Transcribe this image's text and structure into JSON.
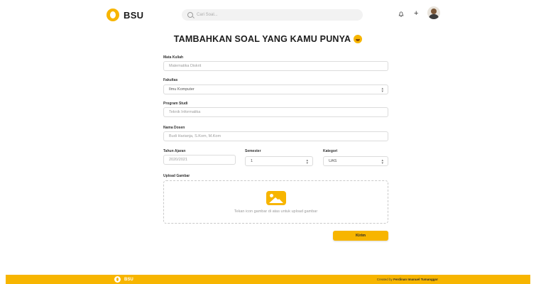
{
  "header": {
    "logo_text": "BSU",
    "search_placeholder": "Cari Soal..."
  },
  "title": "TAMBAHKAN SOAL YANG KAMU PUNYA",
  "form": {
    "mata_kuliah": {
      "label": "Mata Kuliah",
      "value": "Matematika Diskrit"
    },
    "fakultas": {
      "label": "Fakultas",
      "value": "Ilmu Komputer"
    },
    "program_studi": {
      "label": "Program Studi",
      "value": "Teknik Informatika"
    },
    "nama_dosen": {
      "label": "Nama Dosen",
      "value": "Budi Harianja, S.Kom, M.Kom"
    },
    "tahun_ajaran": {
      "label": "Tahun Ajaran",
      "value": "2020/2021"
    },
    "semester": {
      "label": "Semester",
      "value": "1"
    },
    "kategori": {
      "label": "Kategori",
      "value": "UAS"
    },
    "upload": {
      "label": "Upload Gambar",
      "hint": "Tekan icon gambar di atas untuk upload gambar"
    },
    "submit_label": "Kirim"
  },
  "footer": {
    "logo_text": "BSU",
    "credit_prefix": "Created by",
    "credit_name": "Ferdinan Imanuel Tumanggor"
  },
  "colors": {
    "accent": "#f7b500"
  },
  "icons": {
    "logo": "bsu-logo-icon",
    "search": "search-icon",
    "notification": "bell-icon",
    "add": "plus-icon",
    "avatar": "user-avatar",
    "title_emoji": "smiling-face-icon",
    "upload": "image-upload-icon",
    "select_chevron": "chevron-up-down-icon"
  }
}
